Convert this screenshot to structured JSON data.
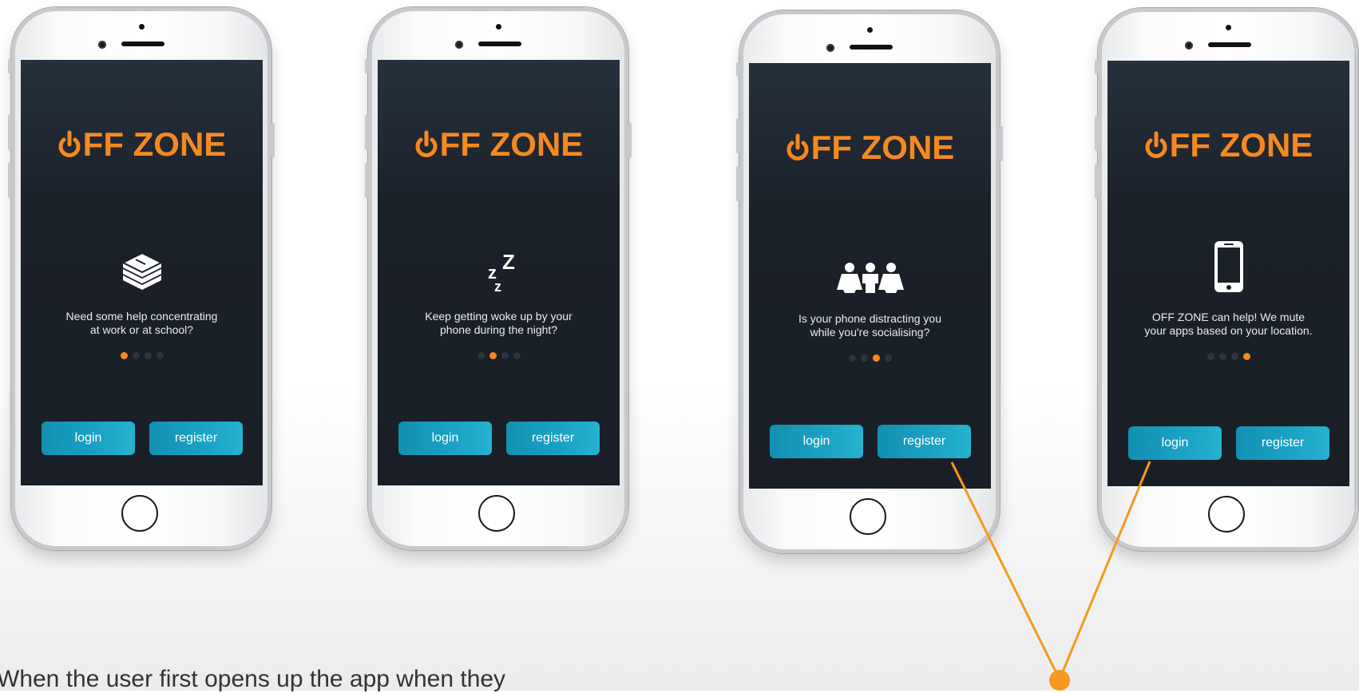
{
  "app": {
    "logo_text": "FF ZONE",
    "brand_color": "#f5891f",
    "button_color": "#1ba3c4"
  },
  "screens": [
    {
      "icon": "book-stack-icon",
      "caption_line1": "Need some help concentrating",
      "caption_line2": "at work or at school?",
      "active_dot": 0,
      "login_label": "login",
      "register_label": "register"
    },
    {
      "icon": "sleep-zzz-icon",
      "caption_line1": "Keep getting woke up by your",
      "caption_line2": "phone during the night?",
      "active_dot": 1,
      "login_label": "login",
      "register_label": "register"
    },
    {
      "icon": "people-group-icon",
      "caption_line1": "Is your phone distracting you",
      "caption_line2": "while you're socialising?",
      "active_dot": 2,
      "login_label": "login",
      "register_label": "register"
    },
    {
      "icon": "smartphone-icon",
      "caption_line1": "OFF ZONE can help! We mute",
      "caption_line2": "your apps based on your location.",
      "active_dot": 3,
      "login_label": "login",
      "register_label": "register"
    }
  ],
  "footer": {
    "text": "When the user first opens up the app when they"
  }
}
